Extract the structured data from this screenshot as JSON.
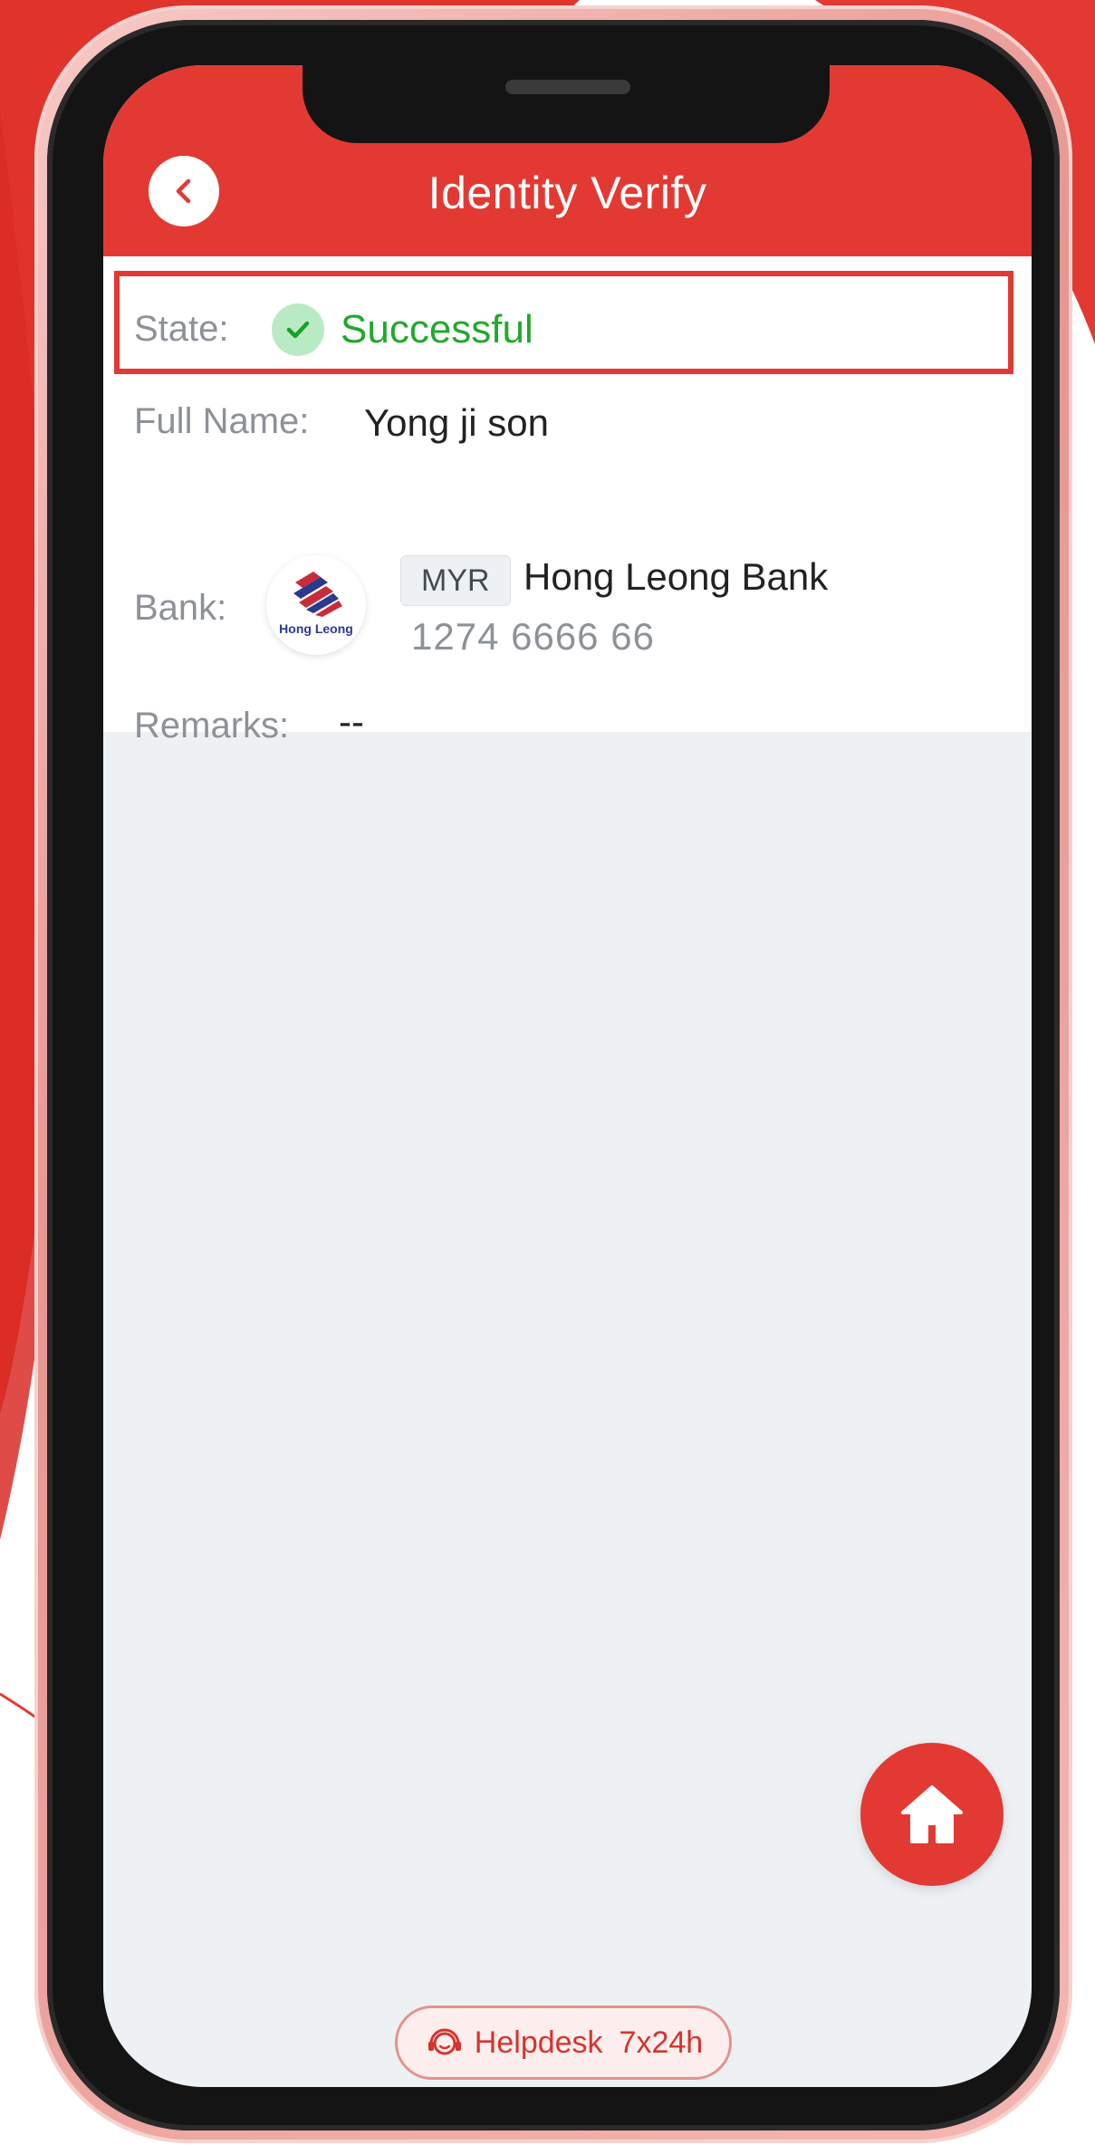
{
  "header": {
    "title": "Identity Verify"
  },
  "details": {
    "state_label": "State:",
    "state_value": "Successful",
    "full_name_label": "Full Name:",
    "full_name_value": "Yong ji son",
    "bank_label": "Bank:",
    "bank_currency": "MYR",
    "bank_name": "Hong Leong Bank",
    "bank_logo_text": "Hong Leong",
    "account_number": "1274 6666 66",
    "remarks_label": "Remarks:",
    "remarks_value": "--"
  },
  "footer": {
    "helpdesk_label": "Helpdesk",
    "helpdesk_hours": "7x24h"
  },
  "icons": {
    "back": "chevron-left-icon",
    "state": "check-circle-icon",
    "home": "home-icon",
    "helpdesk": "headset-icon"
  },
  "colors": {
    "accent": "#e23a33",
    "success": "#22a82c",
    "screen_bg": "#eef1f4"
  }
}
